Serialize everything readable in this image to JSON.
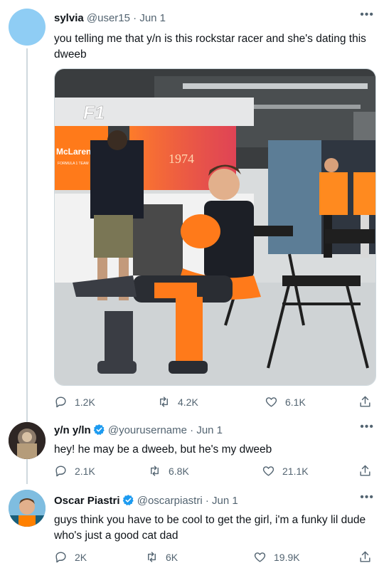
{
  "tweets": [
    {
      "name": "sylvia",
      "handle": "@user15",
      "date": "Jun 1",
      "text": "you telling me that y/n is this rockstar racer and she's dating this dweeb",
      "replies": "1.2K",
      "retweets": "4.2K",
      "likes": "6.1K",
      "avatar_color": "#8fcdf4",
      "has_media": true
    },
    {
      "name": "y/n y/ln",
      "handle": "@yourusername",
      "date": "Jun 1",
      "verified": true,
      "text": "hey! he may be a dweeb, but he's my dweeb",
      "replies": "2.1K",
      "retweets": "6.8K",
      "likes": "21.1K"
    },
    {
      "name": "Oscar Piastri",
      "handle": "@oscarpiastri",
      "date": "Jun 1",
      "verified": true,
      "text": "guys think you have to be cool to get the girl, i'm a funky lil dude who's just a good cat dad",
      "replies": "2K",
      "retweets": "6K",
      "likes": "19.9K"
    }
  ],
  "media": {
    "banner_text": "McLaren",
    "banner_subtext": "FORMULA 1 TEAM",
    "number_text": "1974"
  },
  "colors": {
    "accent": "#1d9bf0",
    "secondary_text": "#536471",
    "thread_line": "#cfd9de",
    "papaya": "#ff8000"
  },
  "icons": {
    "reply": "reply-icon",
    "retweet": "retweet-icon",
    "like": "heart-icon",
    "share": "share-icon",
    "more": "more-icon",
    "verified": "verified-badge-icon"
  }
}
